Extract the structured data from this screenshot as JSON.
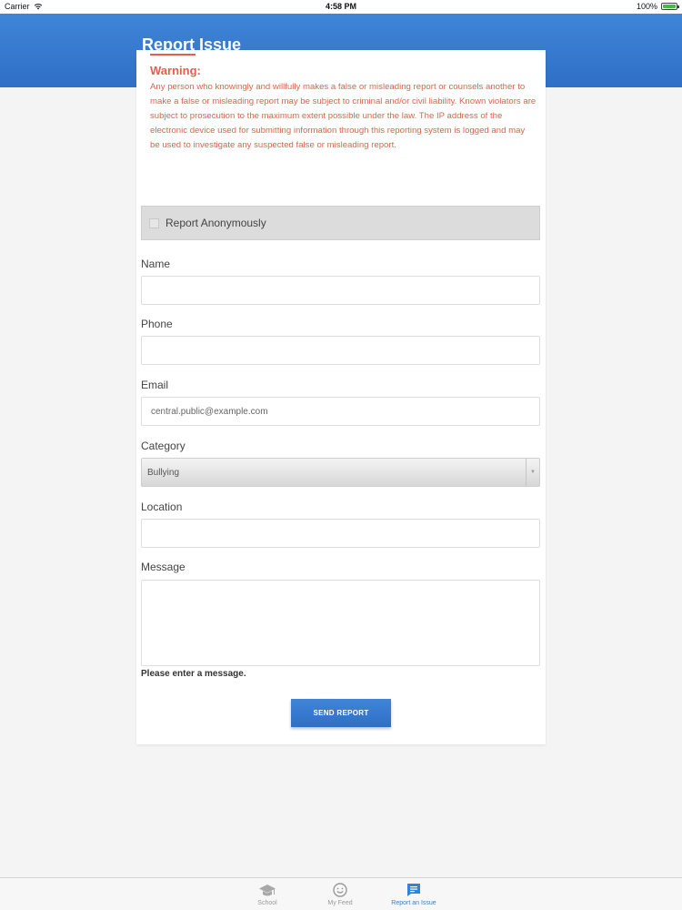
{
  "status_bar": {
    "carrier": "Carrier",
    "time": "4:58 PM",
    "battery": "100%",
    "wifi_icon": "wifi-icon",
    "battery_icon": "battery-icon",
    "battery_level": 1.0
  },
  "header": {
    "title": "Report Issue",
    "color": "#3478d0"
  },
  "warning": {
    "title": "Warning:",
    "text": "Any person who knowingly and willfully makes a false or misleading report or counsels another to make a false or misleading report may be subject to criminal and/or civil liability. Known violators are subject to prosecution to the maximum extent possible under the law. The IP address of the electronic device used for submitting information through this reporting system is logged and may be used to investigate any suspected false or misleading report.",
    "color": "#e4604c"
  },
  "anonymous": {
    "label": "Report Anonymously",
    "checked": false
  },
  "form": {
    "name_label": "Name",
    "name_value": "",
    "phone_label": "Phone",
    "phone_value": "",
    "email_label": "Email",
    "email_value": "central.public@example.com",
    "category_label": "Category",
    "category_value": "Bullying",
    "location_label": "Location",
    "location_value": "",
    "message_label": "Message",
    "message_value": "",
    "error": "Please enter a message.",
    "submit_label": "SEND REPORT"
  },
  "tab_bar": {
    "tabs": [
      {
        "label": "School",
        "icon": "graduation-cap-icon",
        "active": false
      },
      {
        "label": "My Feed",
        "icon": "smiley-icon",
        "active": false
      },
      {
        "label": "Report an Issue",
        "icon": "chat-bubble-icon",
        "active": true
      }
    ],
    "active_color": "#2f84d9"
  }
}
